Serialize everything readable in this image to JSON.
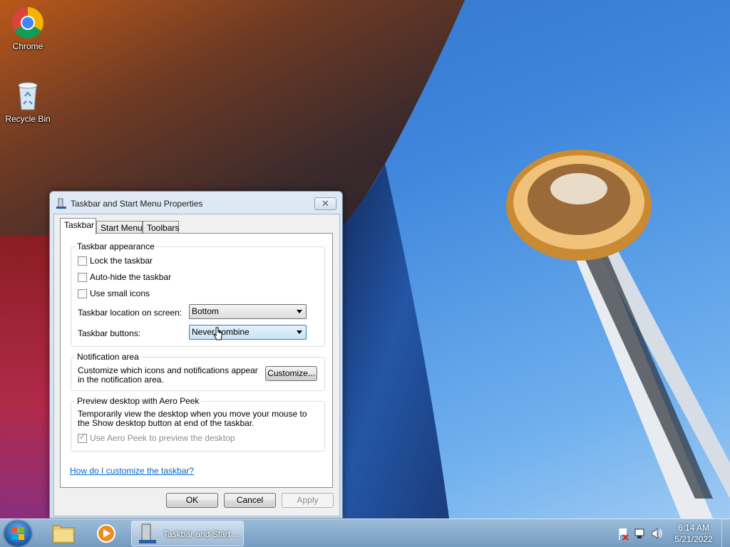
{
  "desktop": {
    "icons": [
      {
        "label": "Chrome"
      },
      {
        "label": "Recycle Bin"
      }
    ]
  },
  "dialog": {
    "title": "Taskbar and Start Menu Properties",
    "close_label": "✕",
    "tabs": [
      {
        "label": "Taskbar",
        "active": true
      },
      {
        "label": "Start Menu",
        "active": false
      },
      {
        "label": "Toolbars",
        "active": false
      }
    ],
    "appearance": {
      "title": "Taskbar appearance",
      "lock_label": "Lock the taskbar",
      "lock_checked": false,
      "autohide_label": "Auto-hide the taskbar",
      "autohide_checked": false,
      "small_icons_label": "Use small icons",
      "small_icons_checked": false,
      "location_label": "Taskbar location on screen:",
      "location_value": "Bottom",
      "buttons_label": "Taskbar buttons:",
      "buttons_value": "Never combine"
    },
    "notification": {
      "title": "Notification area",
      "text": "Customize which icons and notifications appear in the notification area.",
      "customize_label": "Customize..."
    },
    "aero_peek": {
      "title": "Preview desktop with Aero Peek",
      "text": "Temporarily view the desktop when you move your mouse to the Show desktop button at end of the taskbar.",
      "checkbox_label": "Use Aero Peek to preview the desktop",
      "checked": true
    },
    "help_link": "How do I customize the taskbar?",
    "buttons": {
      "ok": "OK",
      "cancel": "Cancel",
      "apply": "Apply"
    }
  },
  "taskbar": {
    "task_label": "Taskbar and Start ...",
    "clock_time": "6:14 AM",
    "clock_date": "5/21/2022"
  }
}
